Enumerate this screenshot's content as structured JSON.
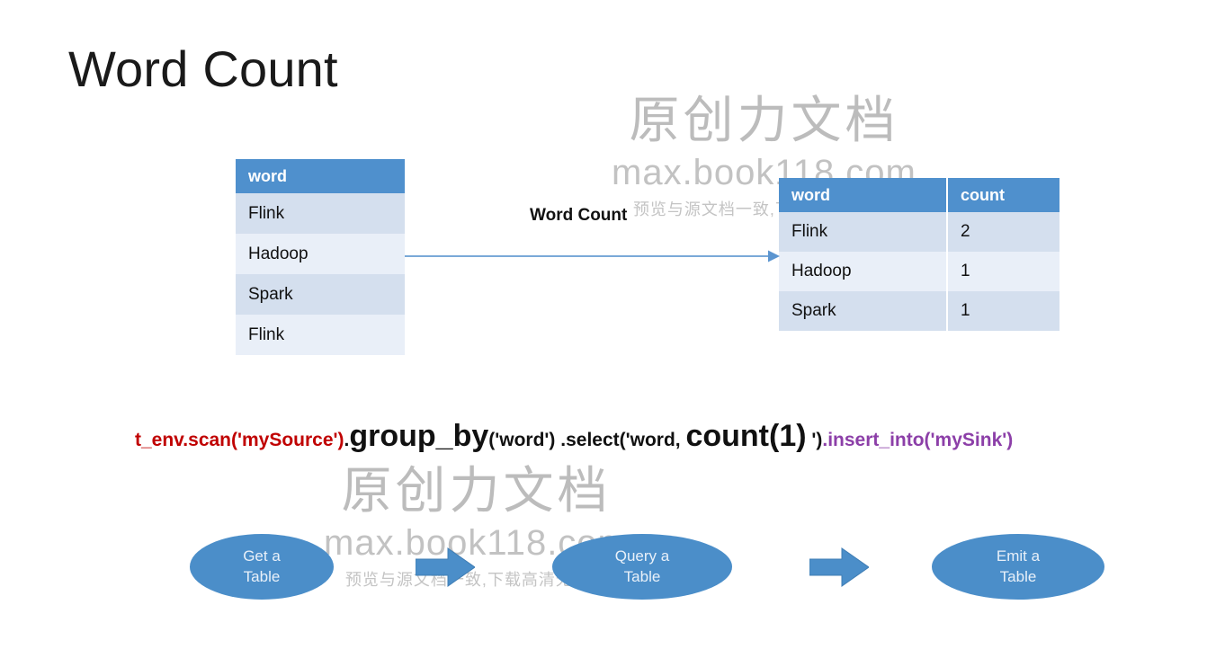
{
  "slide": {
    "title": "Word Count",
    "background": "#ffffff"
  },
  "colors": {
    "table_header_blue": "#4f90cd",
    "table_row_dark": "#d4dfee",
    "table_row_light": "#e9eff8",
    "shape_blue": "#4b8ec9",
    "arrow_blue": "#7aa9d8",
    "code_red": "#c00000",
    "code_purple": "#8c3fa8",
    "code_black": "#111111",
    "watermark_gray": "#bcbcbc"
  },
  "source_table": {
    "name": "source-table",
    "columns": [
      "word"
    ],
    "rows": [
      [
        "Flink"
      ],
      [
        "Hadoop"
      ],
      [
        "Spark"
      ],
      [
        "Flink"
      ]
    ]
  },
  "result_table": {
    "name": "result-table",
    "columns": [
      "word",
      "count"
    ],
    "rows": [
      [
        "Flink",
        "2"
      ],
      [
        "Hadoop",
        "1"
      ],
      [
        "Spark",
        "1"
      ]
    ]
  },
  "transform_arrow": {
    "label": "Word Count",
    "icon": "arrow-right-icon"
  },
  "code_line": {
    "full_text": "t_env.scan('mySource').group_by('word') .select('word, count(1) ').insert_into('mySink')",
    "segments": [
      {
        "text": "t_env.scan('mySource')",
        "style": "red-small"
      },
      {
        "text": ".",
        "style": "black-small"
      },
      {
        "text": "group_by",
        "style": "black-large"
      },
      {
        "text": "('word') .select('word, ",
        "style": "black-small"
      },
      {
        "text": "count(1)",
        "style": "black-large"
      },
      {
        "text": " ')",
        "style": "black-small"
      },
      {
        "text": ".insert_into('mySink')",
        "style": "purple-small"
      }
    ]
  },
  "flow": {
    "steps": [
      {
        "name": "get-a-table",
        "line1": "Get a",
        "line2": "Table"
      },
      {
        "name": "query-a-table",
        "line1": "Query a",
        "line2": "Table"
      },
      {
        "name": "emit-a-table",
        "line1": "Emit a",
        "line2": "Table"
      }
    ],
    "arrow_icon": "block-arrow-right-icon"
  },
  "watermark": {
    "big": "原创力文档",
    "mid": "max.book118.com",
    "small": "预览与源文档一致,下载高清无水印"
  }
}
